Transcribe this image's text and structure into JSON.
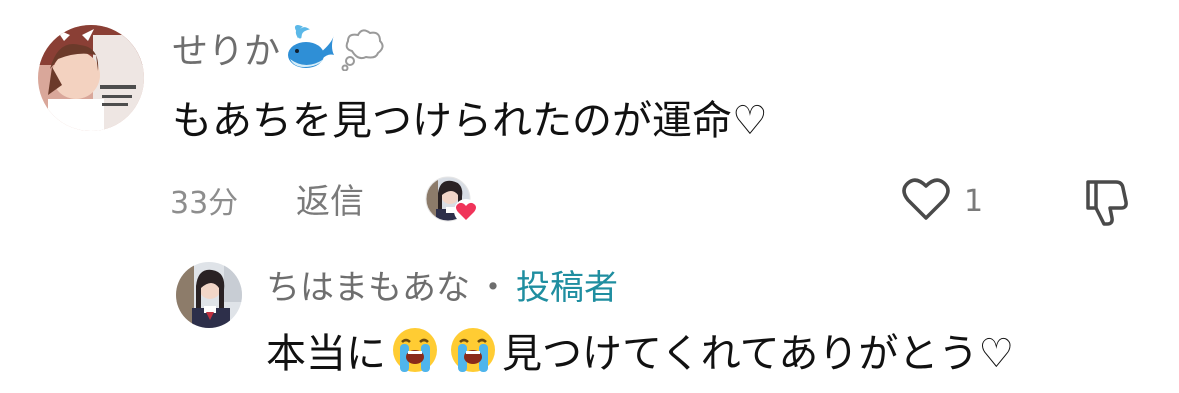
{
  "comment": {
    "username": "せりか",
    "username_emojis": [
      "whale-icon",
      "thought-balloon-icon"
    ],
    "text": "もあちを見つけられたのが運命♡",
    "time": "33分",
    "reply_label": "返信",
    "like_count": "1",
    "creator_liked": true
  },
  "reply": {
    "username": "ちはまもあな",
    "separator": "・",
    "badge": "投稿者",
    "text_before": "本当に",
    "emojis": [
      "loudly-crying-face-icon",
      "loudly-crying-face-icon"
    ],
    "text_after": "見つけてくれてありがとう♡"
  },
  "colors": {
    "name_gray": "#6e6e6e",
    "meta_gray": "#8d8d8d",
    "text": "#111111",
    "creator_badge": "#1f8ea0",
    "heart_red": "#f0345a"
  }
}
